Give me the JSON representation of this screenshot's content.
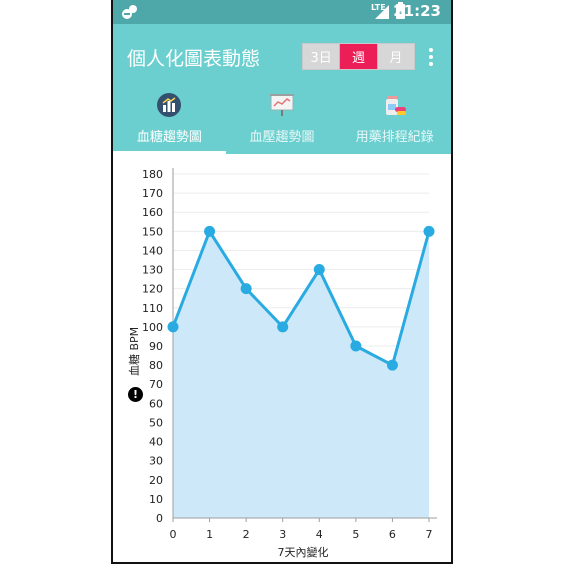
{
  "status_bar": {
    "network": "LTE",
    "battery_mark": "!",
    "time": "21:23"
  },
  "app": {
    "title": "個人化圖表動態",
    "range_options": [
      "3日",
      "週",
      "月"
    ],
    "range_selected": "週",
    "colors": {
      "header": "#6ccfcf",
      "status_bar": "#4ea7a8",
      "accent": "#ec1e57",
      "series": "#29abe2",
      "fill": "#cde9f9"
    }
  },
  "tabs": [
    {
      "label": "血糖趨勢圖",
      "icon": "bar-chart-icon",
      "active": true
    },
    {
      "label": "血壓趨勢圖",
      "icon": "presentation-board-icon",
      "active": false
    },
    {
      "label": "用藥排程紀錄",
      "icon": "pill-bottle-icon",
      "active": false
    }
  ],
  "chart": {
    "warning_icon_mark": "!"
  },
  "chart_data": {
    "type": "area",
    "x": [
      0,
      1,
      2,
      3,
      4,
      5,
      6,
      7
    ],
    "values": [
      100,
      150,
      120,
      100,
      130,
      90,
      80,
      150
    ],
    "xlabel": "7天內變化",
    "ylabel": "血糖 BPM",
    "ylim": [
      0,
      180
    ],
    "yticks": [
      0,
      10,
      20,
      30,
      40,
      50,
      60,
      70,
      80,
      90,
      100,
      110,
      120,
      130,
      140,
      150,
      160,
      170,
      180
    ],
    "xticks": [
      0,
      1,
      2,
      3,
      4,
      5,
      6,
      7
    ],
    "grid": "horizontal",
    "legend": "none"
  }
}
